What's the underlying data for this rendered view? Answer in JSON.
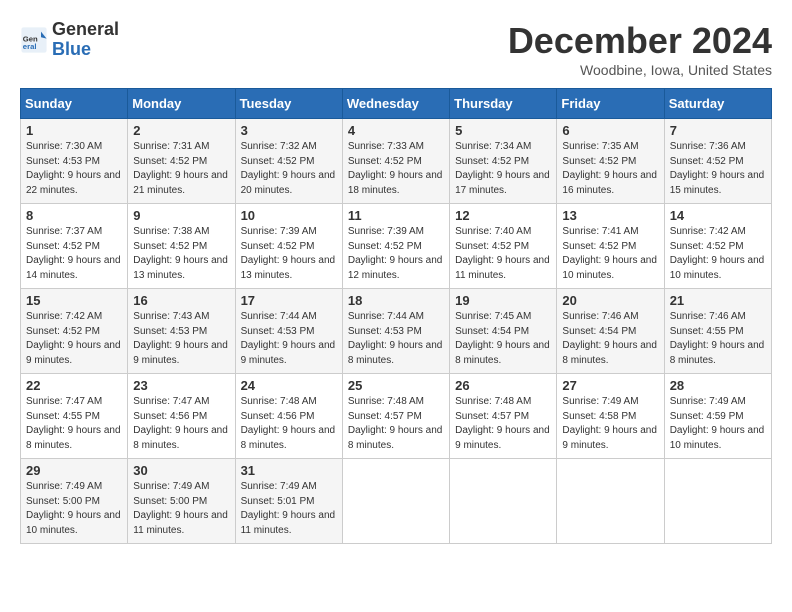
{
  "header": {
    "logo_general": "General",
    "logo_blue": "Blue",
    "month_title": "December 2024",
    "location": "Woodbine, Iowa, United States"
  },
  "weekdays": [
    "Sunday",
    "Monday",
    "Tuesday",
    "Wednesday",
    "Thursday",
    "Friday",
    "Saturday"
  ],
  "weeks": [
    [
      {
        "day": "1",
        "sunrise": "Sunrise: 7:30 AM",
        "sunset": "Sunset: 4:53 PM",
        "daylight": "Daylight: 9 hours and 22 minutes."
      },
      {
        "day": "2",
        "sunrise": "Sunrise: 7:31 AM",
        "sunset": "Sunset: 4:52 PM",
        "daylight": "Daylight: 9 hours and 21 minutes."
      },
      {
        "day": "3",
        "sunrise": "Sunrise: 7:32 AM",
        "sunset": "Sunset: 4:52 PM",
        "daylight": "Daylight: 9 hours and 20 minutes."
      },
      {
        "day": "4",
        "sunrise": "Sunrise: 7:33 AM",
        "sunset": "Sunset: 4:52 PM",
        "daylight": "Daylight: 9 hours and 18 minutes."
      },
      {
        "day": "5",
        "sunrise": "Sunrise: 7:34 AM",
        "sunset": "Sunset: 4:52 PM",
        "daylight": "Daylight: 9 hours and 17 minutes."
      },
      {
        "day": "6",
        "sunrise": "Sunrise: 7:35 AM",
        "sunset": "Sunset: 4:52 PM",
        "daylight": "Daylight: 9 hours and 16 minutes."
      },
      {
        "day": "7",
        "sunrise": "Sunrise: 7:36 AM",
        "sunset": "Sunset: 4:52 PM",
        "daylight": "Daylight: 9 hours and 15 minutes."
      }
    ],
    [
      {
        "day": "8",
        "sunrise": "Sunrise: 7:37 AM",
        "sunset": "Sunset: 4:52 PM",
        "daylight": "Daylight: 9 hours and 14 minutes."
      },
      {
        "day": "9",
        "sunrise": "Sunrise: 7:38 AM",
        "sunset": "Sunset: 4:52 PM",
        "daylight": "Daylight: 9 hours and 13 minutes."
      },
      {
        "day": "10",
        "sunrise": "Sunrise: 7:39 AM",
        "sunset": "Sunset: 4:52 PM",
        "daylight": "Daylight: 9 hours and 13 minutes."
      },
      {
        "day": "11",
        "sunrise": "Sunrise: 7:39 AM",
        "sunset": "Sunset: 4:52 PM",
        "daylight": "Daylight: 9 hours and 12 minutes."
      },
      {
        "day": "12",
        "sunrise": "Sunrise: 7:40 AM",
        "sunset": "Sunset: 4:52 PM",
        "daylight": "Daylight: 9 hours and 11 minutes."
      },
      {
        "day": "13",
        "sunrise": "Sunrise: 7:41 AM",
        "sunset": "Sunset: 4:52 PM",
        "daylight": "Daylight: 9 hours and 10 minutes."
      },
      {
        "day": "14",
        "sunrise": "Sunrise: 7:42 AM",
        "sunset": "Sunset: 4:52 PM",
        "daylight": "Daylight: 9 hours and 10 minutes."
      }
    ],
    [
      {
        "day": "15",
        "sunrise": "Sunrise: 7:42 AM",
        "sunset": "Sunset: 4:52 PM",
        "daylight": "Daylight: 9 hours and 9 minutes."
      },
      {
        "day": "16",
        "sunrise": "Sunrise: 7:43 AM",
        "sunset": "Sunset: 4:53 PM",
        "daylight": "Daylight: 9 hours and 9 minutes."
      },
      {
        "day": "17",
        "sunrise": "Sunrise: 7:44 AM",
        "sunset": "Sunset: 4:53 PM",
        "daylight": "Daylight: 9 hours and 9 minutes."
      },
      {
        "day": "18",
        "sunrise": "Sunrise: 7:44 AM",
        "sunset": "Sunset: 4:53 PM",
        "daylight": "Daylight: 9 hours and 8 minutes."
      },
      {
        "day": "19",
        "sunrise": "Sunrise: 7:45 AM",
        "sunset": "Sunset: 4:54 PM",
        "daylight": "Daylight: 9 hours and 8 minutes."
      },
      {
        "day": "20",
        "sunrise": "Sunrise: 7:46 AM",
        "sunset": "Sunset: 4:54 PM",
        "daylight": "Daylight: 9 hours and 8 minutes."
      },
      {
        "day": "21",
        "sunrise": "Sunrise: 7:46 AM",
        "sunset": "Sunset: 4:55 PM",
        "daylight": "Daylight: 9 hours and 8 minutes."
      }
    ],
    [
      {
        "day": "22",
        "sunrise": "Sunrise: 7:47 AM",
        "sunset": "Sunset: 4:55 PM",
        "daylight": "Daylight: 9 hours and 8 minutes."
      },
      {
        "day": "23",
        "sunrise": "Sunrise: 7:47 AM",
        "sunset": "Sunset: 4:56 PM",
        "daylight": "Daylight: 9 hours and 8 minutes."
      },
      {
        "day": "24",
        "sunrise": "Sunrise: 7:48 AM",
        "sunset": "Sunset: 4:56 PM",
        "daylight": "Daylight: 9 hours and 8 minutes."
      },
      {
        "day": "25",
        "sunrise": "Sunrise: 7:48 AM",
        "sunset": "Sunset: 4:57 PM",
        "daylight": "Daylight: 9 hours and 8 minutes."
      },
      {
        "day": "26",
        "sunrise": "Sunrise: 7:48 AM",
        "sunset": "Sunset: 4:57 PM",
        "daylight": "Daylight: 9 hours and 9 minutes."
      },
      {
        "day": "27",
        "sunrise": "Sunrise: 7:49 AM",
        "sunset": "Sunset: 4:58 PM",
        "daylight": "Daylight: 9 hours and 9 minutes."
      },
      {
        "day": "28",
        "sunrise": "Sunrise: 7:49 AM",
        "sunset": "Sunset: 4:59 PM",
        "daylight": "Daylight: 9 hours and 10 minutes."
      }
    ],
    [
      {
        "day": "29",
        "sunrise": "Sunrise: 7:49 AM",
        "sunset": "Sunset: 5:00 PM",
        "daylight": "Daylight: 9 hours and 10 minutes."
      },
      {
        "day": "30",
        "sunrise": "Sunrise: 7:49 AM",
        "sunset": "Sunset: 5:00 PM",
        "daylight": "Daylight: 9 hours and 11 minutes."
      },
      {
        "day": "31",
        "sunrise": "Sunrise: 7:49 AM",
        "sunset": "Sunset: 5:01 PM",
        "daylight": "Daylight: 9 hours and 11 minutes."
      },
      null,
      null,
      null,
      null
    ]
  ]
}
